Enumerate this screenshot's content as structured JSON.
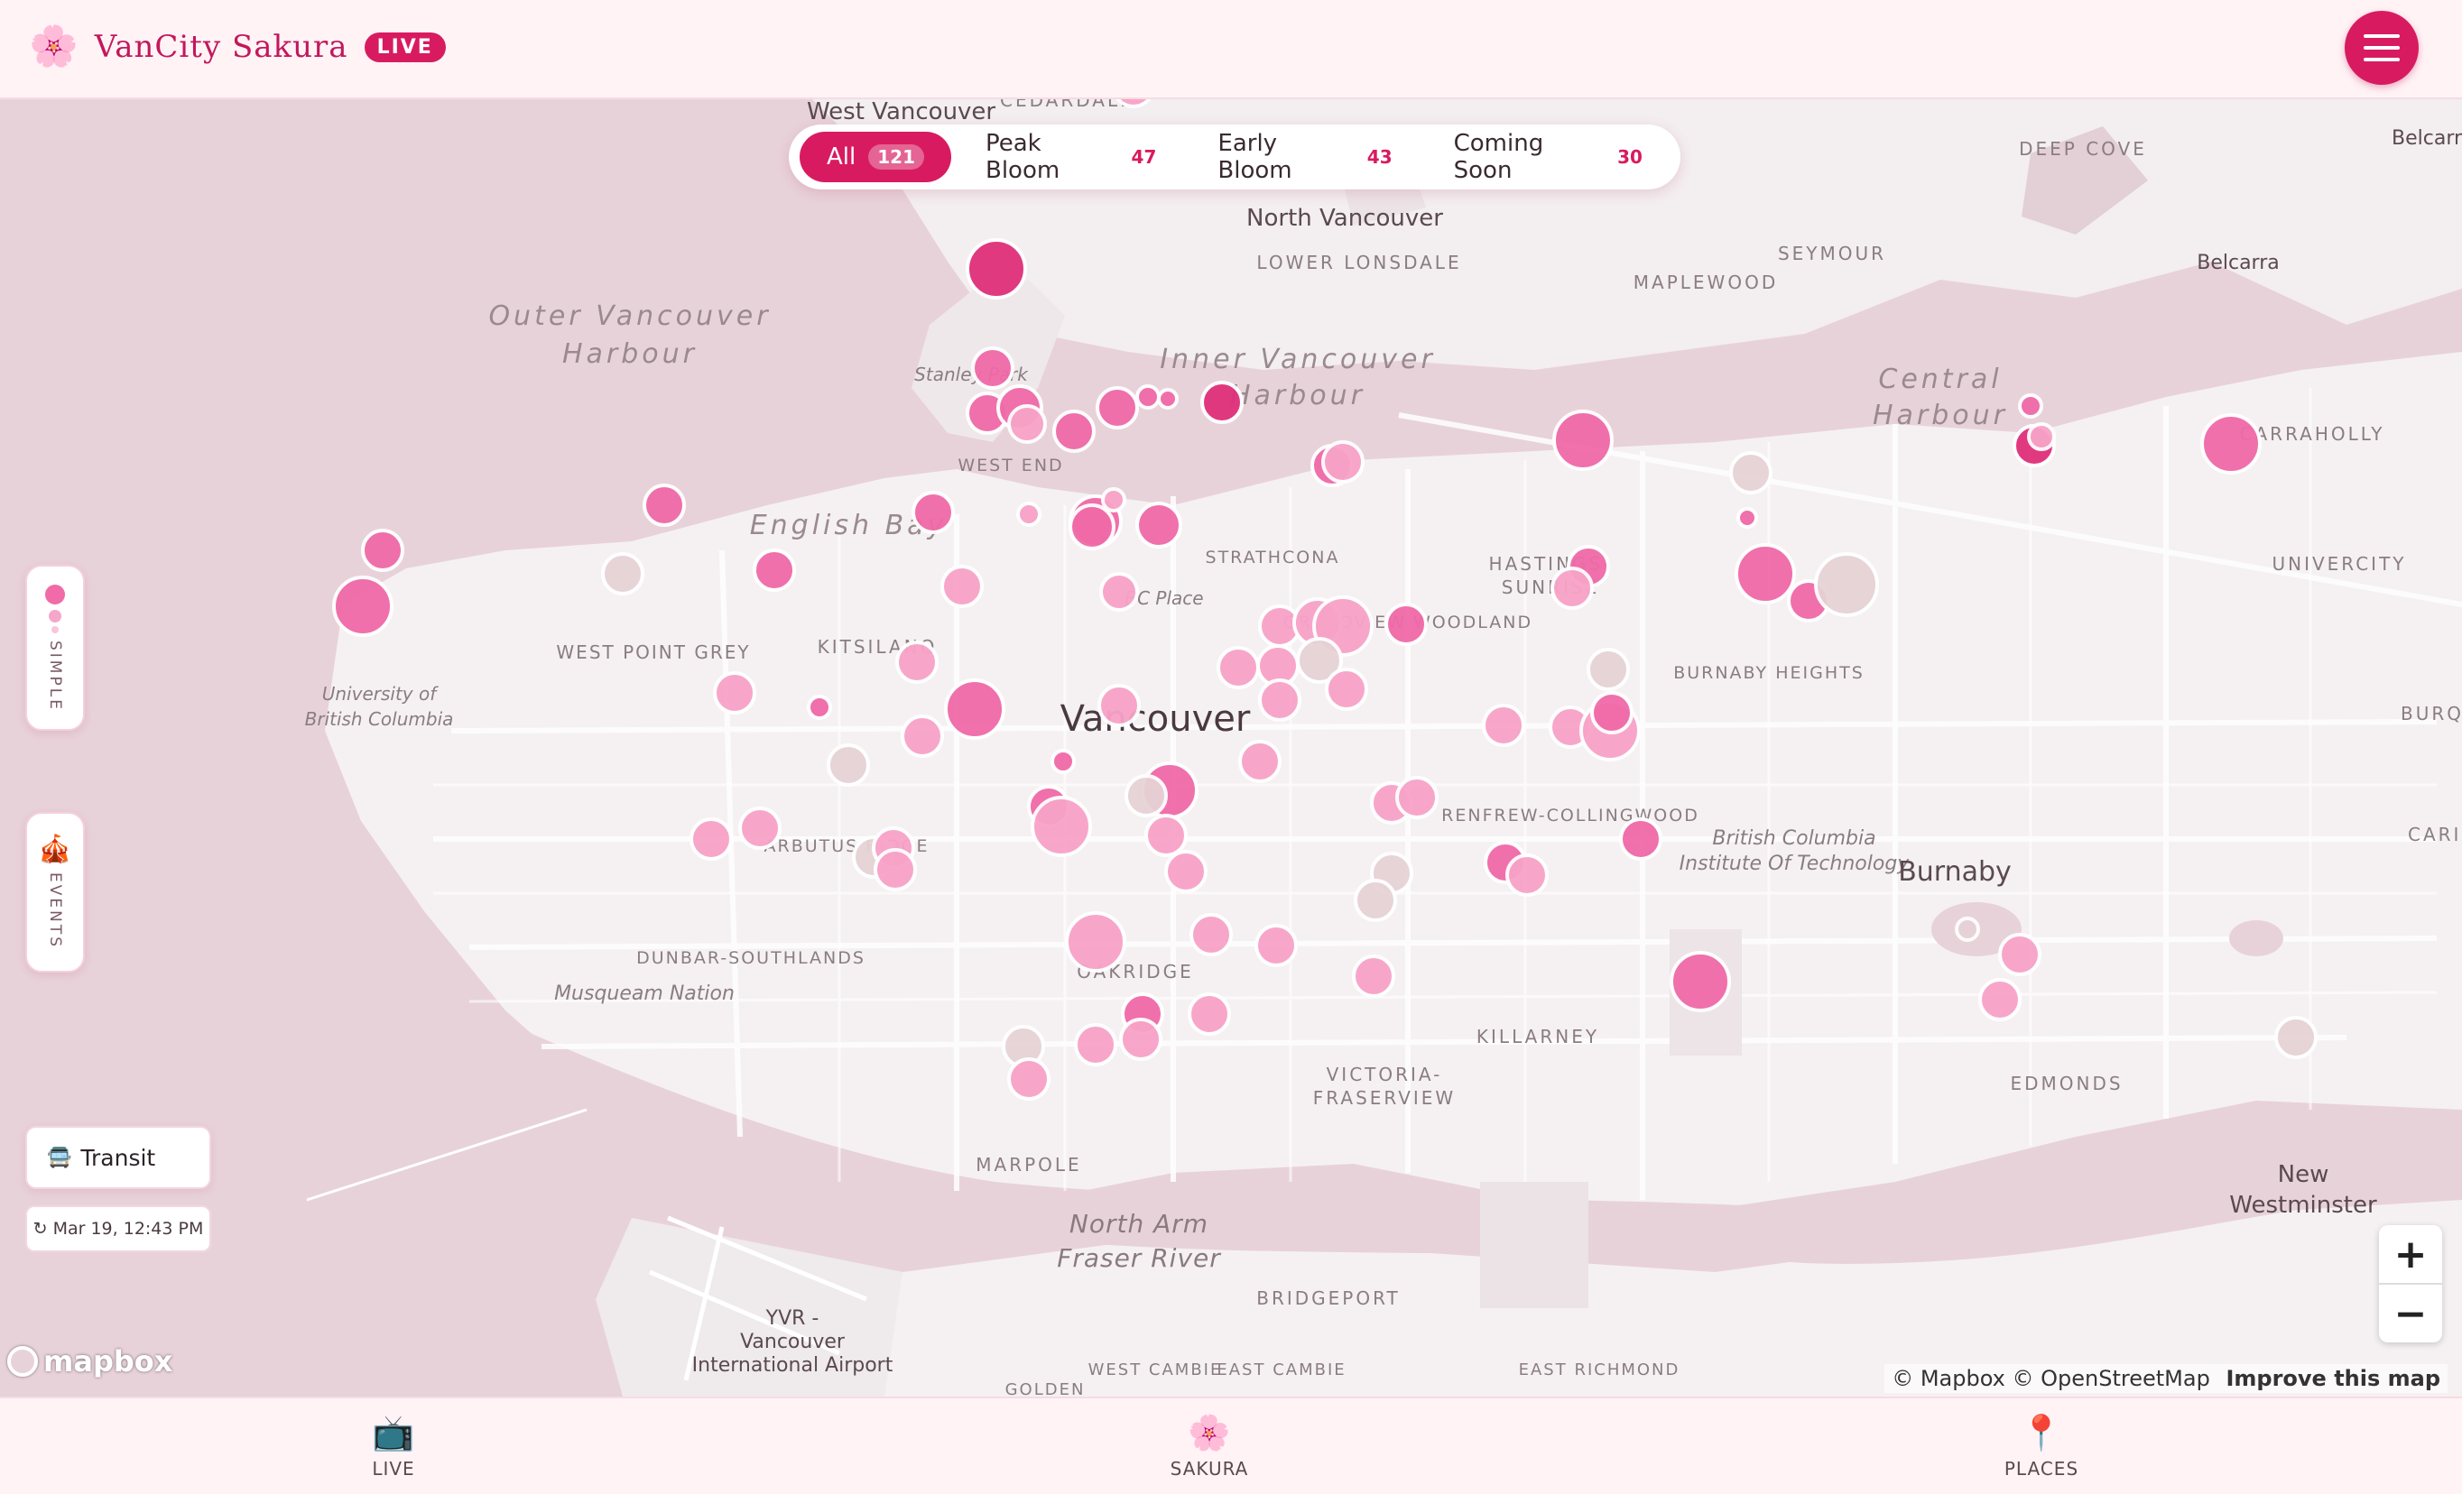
{
  "header": {
    "brand_icon": "cherry-blossom-icon",
    "title": "VanCity Sakura",
    "live_badge": "LIVE",
    "menu_icon": "hamburger-menu-icon"
  },
  "filters": [
    {
      "label": "All",
      "count": "121",
      "active": true
    },
    {
      "label": "Peak Bloom",
      "count": "47",
      "active": false
    },
    {
      "label": "Early Bloom",
      "count": "43",
      "active": false
    },
    {
      "label": "Coming Soon",
      "count": "30",
      "active": false
    }
  ],
  "side_controls": {
    "simple_label": "SIMPLE",
    "events_label": "EVENTS",
    "events_icon": "circus-tent-icon"
  },
  "transit": {
    "icon": "bus-icon",
    "label": "Transit"
  },
  "last_updated": "↻ Mar 19, 12:43 PM",
  "map_labels": {
    "west_vancouver": "West Vancouver",
    "cedardale": "CEDARDALE",
    "north_vancouver": "North Vancouver",
    "lower_lonsdale": "LOWER LONSDALE",
    "maplewood": "MAPLEWOOD",
    "seymour": "SEYMOUR",
    "deep_cove": "DEEP COVE",
    "belcarra": "Belcarra",
    "belcarra2": "Belcarr",
    "outer_harbour_1": "Outer Vancouver",
    "outer_harbour_2": "Harbour",
    "inner_harbour_1": "Inner Vancouver",
    "inner_harbour_2": "Harbour",
    "central_harbour_1": "Central",
    "central_harbour_2": "Harbour",
    "carraholly": "CARRAHOLLY",
    "stanley_park": "Stanley Park",
    "english_bay": "English Bay",
    "west_end": "WEST END",
    "kitsilano": "KITSILANO",
    "west_point_grey": "WEST POINT GREY",
    "ubc_1": "University of",
    "ubc_2": "British Columbia",
    "bc_place": "BC Place",
    "strathcona": "STRATHCONA",
    "grandview": "GRANDVIEW WOODLAND",
    "hastings_1": "HASTINGS-",
    "hastings_2": "SUNRISE",
    "university": "UNIVERCITY",
    "vancouver": "Vancouver",
    "burnaby_heights": "BURNABY HEIGHTS",
    "burquitlam": "BURQUIT",
    "cariboo": "CARIBO",
    "bcit_1": "British Columbia",
    "bcit_2": "Institute Of Technology",
    "burnaby": "Burnaby",
    "arbutus": "ARBUTUS RIDGE",
    "dunbar": "DUNBAR-SOUTHLANDS",
    "musqueam": "Musqueam Nation",
    "oakridge": "OAKRIDGE",
    "renfrew": "RENFREW-COLLINGWOOD",
    "killarney": "KILLARNEY",
    "victoria_1": "VICTORIA-",
    "victoria_2": "FRASERVIEW",
    "edmonds": "EDMONDS",
    "marpole": "MARPOLE",
    "north_arm_1": "North Arm",
    "north_arm_2": "Fraser River",
    "bridgeport": "BRIDGEPORT",
    "yvr_1": "YVR -",
    "yvr_2": "Vancouver",
    "yvr_3": "International Airport",
    "new_west_1": "New",
    "new_west_2": "Westminster",
    "golden": "GOLDEN",
    "west_cambie": "WEST CAMBIE",
    "east_cambie": "EAST CAMBIE",
    "east_richmond": "EAST RICHMOND"
  },
  "attribution": {
    "mapbox": "© Mapbox",
    "osm": "© OpenStreetMap",
    "improve": "Improve this map"
  },
  "mapbox_logo": "mapbox",
  "zoom": {
    "in": "+",
    "out": "−"
  },
  "bottom_nav": [
    {
      "icon": "television-icon",
      "label": "LIVE"
    },
    {
      "icon": "cherry-blossom-icon",
      "label": "SAKURA"
    },
    {
      "icon": "pin-icon",
      "label": "PLACES"
    }
  ],
  "legend_colors": {
    "peak": "#f06aa8",
    "early": "#f8a3c8",
    "soon": "#e6d3d6",
    "featured": "#e0307a"
  }
}
